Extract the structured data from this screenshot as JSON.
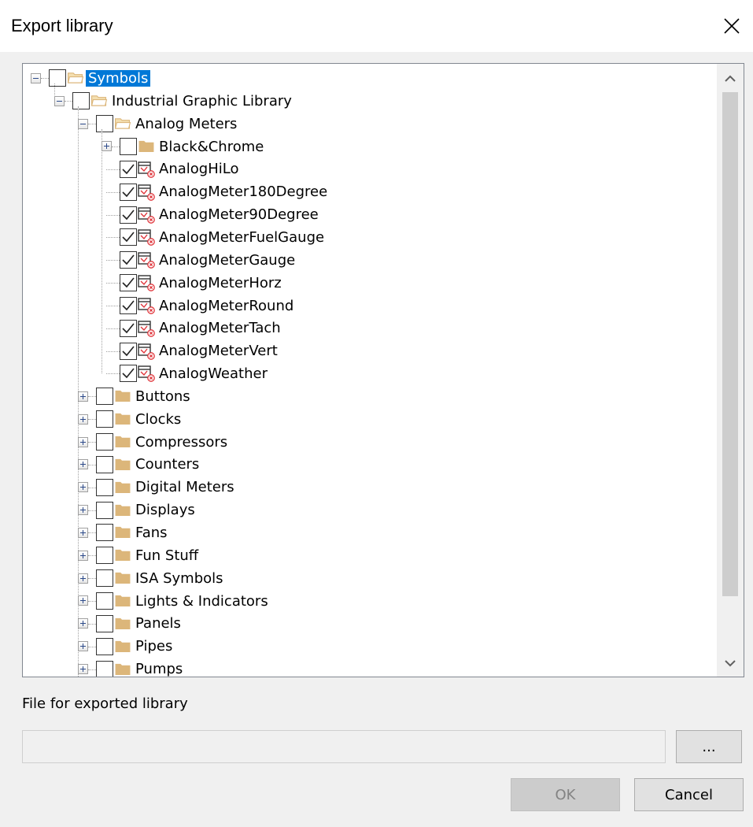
{
  "window": {
    "title": "Export library"
  },
  "tree": {
    "root": {
      "label": "Symbols",
      "selected": true
    },
    "library": {
      "label": "Industrial Graphic Library"
    },
    "folder": {
      "label": "Analog Meters"
    },
    "subfolder": {
      "label": "Black&Chrome"
    },
    "symbols": [
      {
        "label": "AnalogHiLo",
        "checked": true
      },
      {
        "label": "AnalogMeter180Degree",
        "checked": true
      },
      {
        "label": "AnalogMeter90Degree",
        "checked": true
      },
      {
        "label": "AnalogMeterFuelGauge",
        "checked": true
      },
      {
        "label": "AnalogMeterGauge",
        "checked": true
      },
      {
        "label": "AnalogMeterHorz",
        "checked": true
      },
      {
        "label": "AnalogMeterRound",
        "checked": true
      },
      {
        "label": "AnalogMeterTach",
        "checked": true
      },
      {
        "label": "AnalogMeterVert",
        "checked": true
      },
      {
        "label": "AnalogWeather",
        "checked": true
      }
    ],
    "folders": [
      {
        "label": "Buttons"
      },
      {
        "label": "Clocks"
      },
      {
        "label": "Compressors"
      },
      {
        "label": "Counters"
      },
      {
        "label": "Digital Meters"
      },
      {
        "label": "Displays"
      },
      {
        "label": "Fans"
      },
      {
        "label": "Fun Stuff"
      },
      {
        "label": "ISA Symbols"
      },
      {
        "label": "Lights & Indicators"
      },
      {
        "label": "Panels"
      },
      {
        "label": "Pipes"
      },
      {
        "label": "Pumps"
      }
    ]
  },
  "file": {
    "label": "File for exported library",
    "value": ""
  },
  "buttons": {
    "browse": "...",
    "ok": "OK",
    "cancel": "Cancel"
  },
  "colors": {
    "selection": "#0078d7",
    "folder": "#dcb67a",
    "symbol_badge": "#e0343a"
  }
}
